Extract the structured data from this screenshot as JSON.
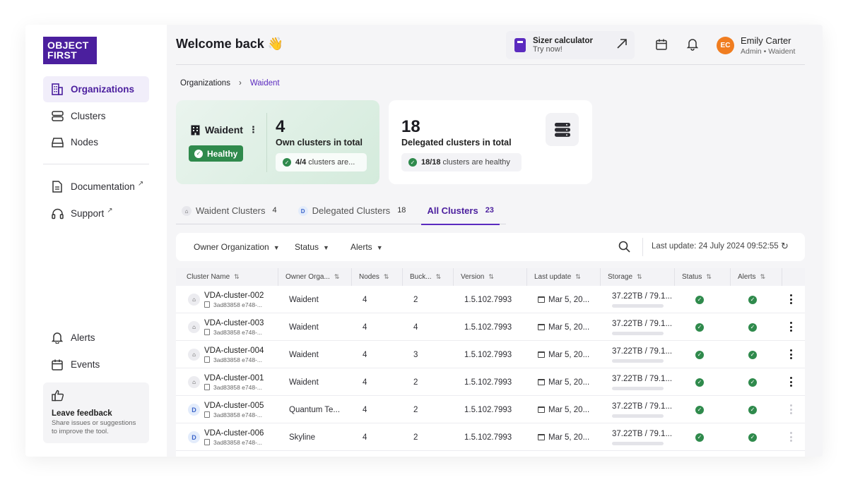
{
  "brand": {
    "line1": "OBJECT",
    "line2": "FIRST",
    "color": "#4b1f9e"
  },
  "sidebar": {
    "items": [
      {
        "label": "Organizations",
        "icon": "building-icon",
        "active": true
      },
      {
        "label": "Clusters",
        "icon": "server-icon"
      },
      {
        "label": "Nodes",
        "icon": "drive-icon"
      },
      {
        "label": "Documentation",
        "icon": "document-icon",
        "external": "↗"
      },
      {
        "label": "Support",
        "icon": "headset-icon",
        "external": "↗"
      },
      {
        "label": "Alerts",
        "icon": "bell-icon"
      },
      {
        "label": "Events",
        "icon": "calendar-icon"
      }
    ],
    "feedback": {
      "title": "Leave feedback",
      "subtitle": "Share issues or suggestions to improve the tool."
    }
  },
  "header": {
    "welcome": "Welcome back 👋",
    "sizer": {
      "title": "Sizer calculator",
      "subtitle": "Try now!"
    },
    "user": {
      "initials": "EC",
      "name": "Emily Carter",
      "role": "Admin  •  Waident"
    }
  },
  "breadcrumb": {
    "root": "Organizations",
    "separator": "›",
    "current": "Waident"
  },
  "org_card": {
    "name": "Waident",
    "status": "Healthy",
    "own_count": "4",
    "own_label": "Own clusters in total",
    "healthy_fraction": "4/4",
    "healthy_text": "clusters are..."
  },
  "delegated_card": {
    "count": "18",
    "label": "Delegated clusters in total",
    "healthy_fraction": "18/18",
    "healthy_text": "clusters are healthy"
  },
  "tabs": [
    {
      "label": "Waident Clusters",
      "count": "4",
      "icon": "home-icon"
    },
    {
      "label": "Delegated Clusters",
      "count": "18",
      "icon": "D"
    },
    {
      "label": "All Clusters",
      "count": "23",
      "active": true
    }
  ],
  "filters": {
    "owner": "Owner Organization",
    "status": "Status",
    "alerts": "Alerts",
    "last_update": "Last update: 24 July 2024 09:52:55"
  },
  "table": {
    "columns": [
      "Cluster Name",
      "Owner Orga...",
      "Nodes",
      "Buck...",
      "Version",
      "Last update",
      "Storage",
      "Status",
      "Alerts"
    ],
    "rows": [
      {
        "type": "home",
        "name": "VDA-cluster-002",
        "id": "3ad83858 e748-...",
        "owner": "Waident",
        "nodes": "4",
        "buckets": "2",
        "version": "1.5.102.7993",
        "updated": "Mar 5, 20...",
        "storage": "37.22TB / 79.1...",
        "storage_pct": 0.3,
        "menu_active": true
      },
      {
        "type": "home",
        "name": "VDA-cluster-003",
        "id": "3ad83858 e748-...",
        "owner": "Waident",
        "nodes": "4",
        "buckets": "4",
        "version": "1.5.102.7993",
        "updated": "Mar 5, 20...",
        "storage": "37.22TB / 79.1...",
        "storage_pct": 0.3,
        "menu_active": true
      },
      {
        "type": "home",
        "name": "VDA-cluster-004",
        "id": "3ad83858 e748-...",
        "owner": "Waident",
        "nodes": "4",
        "buckets": "3",
        "version": "1.5.102.7993",
        "updated": "Mar 5, 20...",
        "storage": "37.22TB / 79.1...",
        "storage_pct": 0.3,
        "menu_active": true
      },
      {
        "type": "home",
        "name": "VDA-cluster-001",
        "id": "3ad83858 e748-...",
        "owner": "Waident",
        "nodes": "4",
        "buckets": "2",
        "version": "1.5.102.7993",
        "updated": "Mar 5, 20...",
        "storage": "37.22TB / 79.1...",
        "storage_pct": 0.3,
        "menu_active": true
      },
      {
        "type": "delegated",
        "name": "VDA-cluster-005",
        "id": "3ad83858 e748-...",
        "owner": "Quantum Te...",
        "nodes": "4",
        "buckets": "2",
        "version": "1.5.102.7993",
        "updated": "Mar 5, 20...",
        "storage": "37.22TB / 79.1...",
        "storage_pct": 0.3,
        "menu_active": false
      },
      {
        "type": "delegated",
        "name": "VDA-cluster-006",
        "id": "3ad83858 e748-...",
        "owner": "Skyline",
        "nodes": "4",
        "buckets": "2",
        "version": "1.5.102.7993",
        "updated": "Mar 5, 20...",
        "storage": "37.22TB / 79.1...",
        "storage_pct": 0.3,
        "menu_active": false
      }
    ]
  },
  "colors": {
    "accent": "#5b2bbf",
    "healthy": "#2f8a4c",
    "avatar": "#f07d20"
  }
}
